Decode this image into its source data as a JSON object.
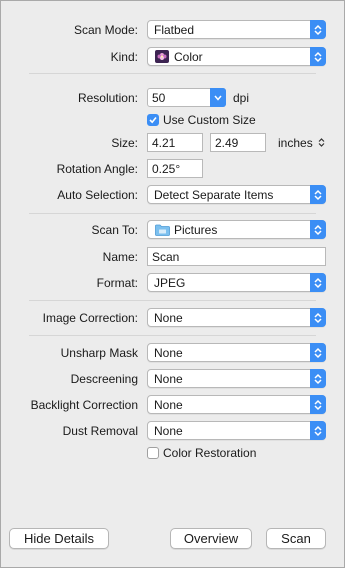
{
  "scan_mode": {
    "label": "Scan Mode:",
    "value": "Flatbed"
  },
  "kind": {
    "label": "Kind:",
    "value": "Color"
  },
  "resolution": {
    "label": "Resolution:",
    "value": "50",
    "unit": "dpi"
  },
  "custom_size": {
    "label": "Use Custom Size",
    "checked": true
  },
  "size": {
    "label": "Size:",
    "width": "4.21",
    "height": "2.49",
    "unit": "inches"
  },
  "rotation": {
    "label": "Rotation Angle:",
    "value": "0.25°"
  },
  "auto_selection": {
    "label": "Auto Selection:",
    "value": "Detect Separate Items"
  },
  "scan_to": {
    "label": "Scan To:",
    "value": "Pictures"
  },
  "name": {
    "label": "Name:",
    "value": "Scan"
  },
  "format": {
    "label": "Format:",
    "value": "JPEG"
  },
  "image_correction": {
    "label": "Image Correction:",
    "value": "None"
  },
  "unsharp_mask": {
    "label": "Unsharp Mask",
    "value": "None"
  },
  "descreening": {
    "label": "Descreening",
    "value": "None"
  },
  "backlight": {
    "label": "Backlight Correction",
    "value": "None"
  },
  "dust_removal": {
    "label": "Dust Removal",
    "value": "None"
  },
  "color_restoration": {
    "label": "Color Restoration",
    "checked": false
  },
  "buttons": {
    "hide_details": "Hide Details",
    "overview": "Overview",
    "scan": "Scan"
  },
  "colors": {
    "accent": "#3b8ef5",
    "background": "#ececec"
  },
  "icons": {
    "kind": "flower-icon",
    "scan_to": "folder-icon",
    "stepper": "chevron-updown-icon"
  }
}
